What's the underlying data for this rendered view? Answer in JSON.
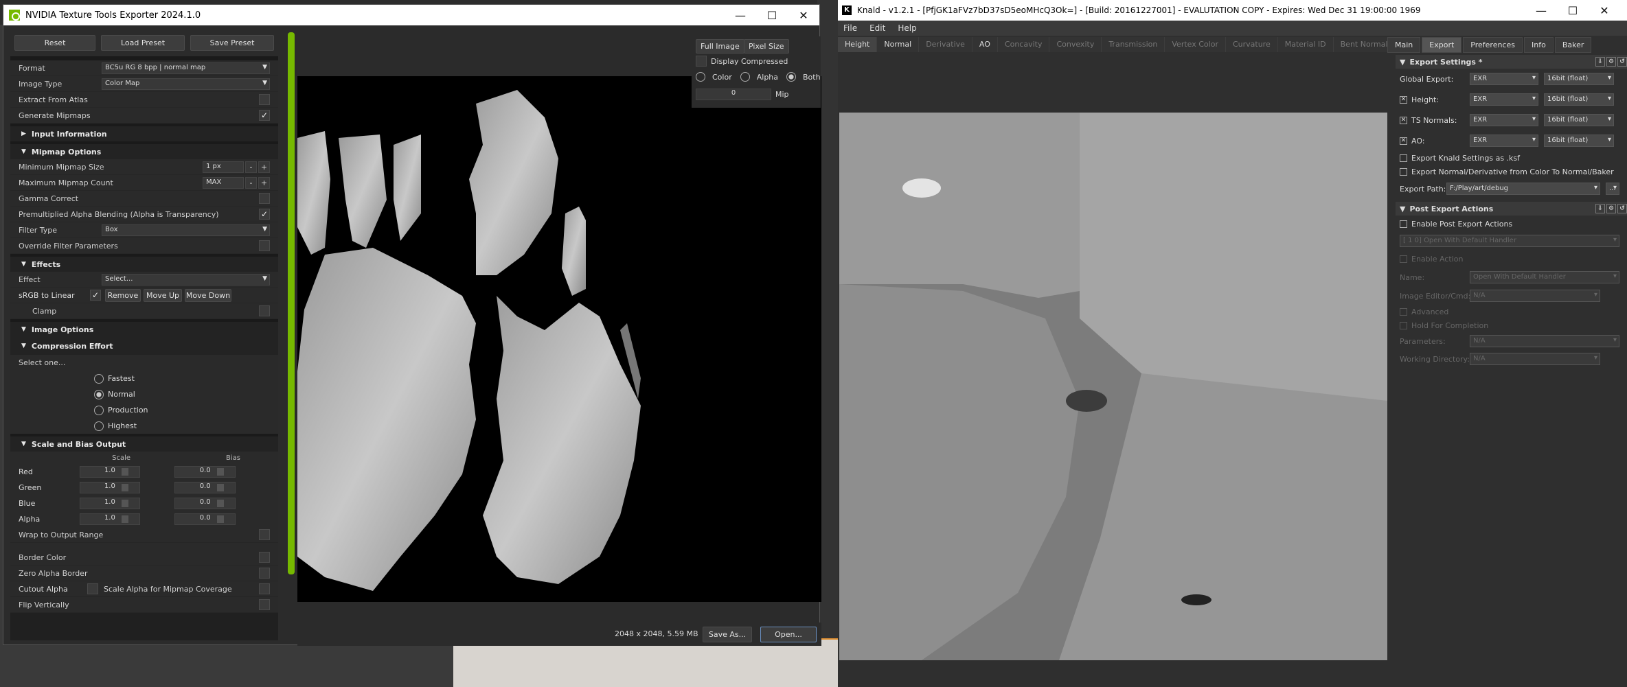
{
  "nvidia": {
    "title": "NVIDIA Texture Tools Exporter 2024.1.0",
    "buttons": {
      "reset": "Reset",
      "load_preset": "Load Preset",
      "save_preset": "Save Preset"
    },
    "format": {
      "label": "Format",
      "value": "BC5u      RG   8 bpp | normal map"
    },
    "image_type": {
      "label": "Image Type",
      "value": "Color Map"
    },
    "extract_from_atlas": "Extract From Atlas",
    "generate_mipmaps": "Generate Mipmaps",
    "input_information": "Input Information",
    "mipmap_options": "Mipmap Options",
    "min_mip_size": {
      "label": "Minimum Mipmap Size",
      "value": "1 px"
    },
    "max_mip_count": {
      "label": "Maximum Mipmap Count",
      "value": "MAX"
    },
    "gamma_correct": "Gamma Correct",
    "premultiplied": "Premultiplied Alpha Blending (Alpha is Transparency)",
    "filter_type": {
      "label": "Filter Type",
      "value": "Box"
    },
    "override_filter": "Override Filter Parameters",
    "effects": "Effects",
    "effect": {
      "label": "Effect",
      "value": "Select..."
    },
    "srgb_to_linear": "sRGB to Linear",
    "effect_buttons": {
      "remove": "Remove",
      "move_up": "Move Up",
      "move_down": "Move Down"
    },
    "clamp": "Clamp",
    "image_options": "Image Options",
    "compression_effort": "Compression Effort",
    "select_one": "Select one...",
    "radios": [
      "Fastest",
      "Normal",
      "Production",
      "Highest"
    ],
    "scale_bias": "Scale and Bias Output",
    "scale_hdr": "Scale",
    "bias_hdr": "Bias",
    "channels": [
      {
        "name": "Red",
        "scale": "1.0",
        "bias": "0.0"
      },
      {
        "name": "Green",
        "scale": "1.0",
        "bias": "0.0"
      },
      {
        "name": "Blue",
        "scale": "1.0",
        "bias": "0.0"
      },
      {
        "name": "Alpha",
        "scale": "1.0",
        "bias": "0.0"
      }
    ],
    "wrap_output": "Wrap to Output Range",
    "border_color": "Border Color",
    "zero_alpha_border": "Zero Alpha Border",
    "cutout_alpha": "Cutout Alpha",
    "scale_alpha": "Scale Alpha for Mipmap Coverage",
    "flip_vertically": "Flip Vertically",
    "view": {
      "full_image": "Full Image",
      "pixel_size": "Pixel Size",
      "display_compressed": "Display Compressed",
      "color": "Color",
      "alpha": "Alpha",
      "both": "Both",
      "mip_value": "0",
      "mip": "Mip"
    },
    "status": "2048 x 2048, 5.59 MB",
    "save_as": "Save As...",
    "open": "Open..."
  },
  "knald": {
    "title": "Knald - v1.2.1 - [PfjGK1aFVz7bD37sD5eoMHcQ3Ok=] - [Build: 20161227001] - EVALUTATION COPY - Expires: Wed Dec 31 19:00:00 1969",
    "menu": [
      "File",
      "Edit",
      "Help"
    ],
    "map_tabs": [
      "Height",
      "Normal",
      "Derivative",
      "AO",
      "Concavity",
      "Convexity",
      "Transmission",
      "Vertex Color",
      "Curvature",
      "Material ID",
      "Bent Normal"
    ],
    "right_tabs": [
      "Main",
      "Export",
      "Preferences",
      "Info",
      "Baker"
    ],
    "export_settings": "Export Settings *",
    "global_export": {
      "label": "Global Export:",
      "format": "EXR",
      "bit": "16bit (float)"
    },
    "height": {
      "label": "Height:",
      "format": "EXR",
      "bit": "16bit (float)"
    },
    "ts_normals": {
      "label": "TS Normals:",
      "format": "EXR",
      "bit": "16bit (float)"
    },
    "ao": {
      "label": "AO:",
      "format": "EXR",
      "bit": "16bit (float)"
    },
    "export_knald": "Export Knald Settings as .ksf",
    "export_normal": "Export Normal/Derivative from Color To Normal/Baker",
    "export_path": {
      "label": "Export Path:",
      "value": "F:/Play/art/debug"
    },
    "post_export": "Post Export Actions",
    "enable_post": "Enable Post Export Actions",
    "handler": "[ 1 0] Open With Default Handler",
    "enable_action": "Enable Action",
    "name": {
      "label": "Name:",
      "value": "Open With Default Handler"
    },
    "image_editor": {
      "label": "Image Editor/Cmd:",
      "value": "N/A"
    },
    "advanced": "Advanced",
    "hold_completion": "Hold For Completion",
    "parameters": {
      "label": "Parameters:",
      "value": "N/A"
    },
    "working_dir": {
      "label": "Working Directory:",
      "value": "N/A"
    }
  }
}
